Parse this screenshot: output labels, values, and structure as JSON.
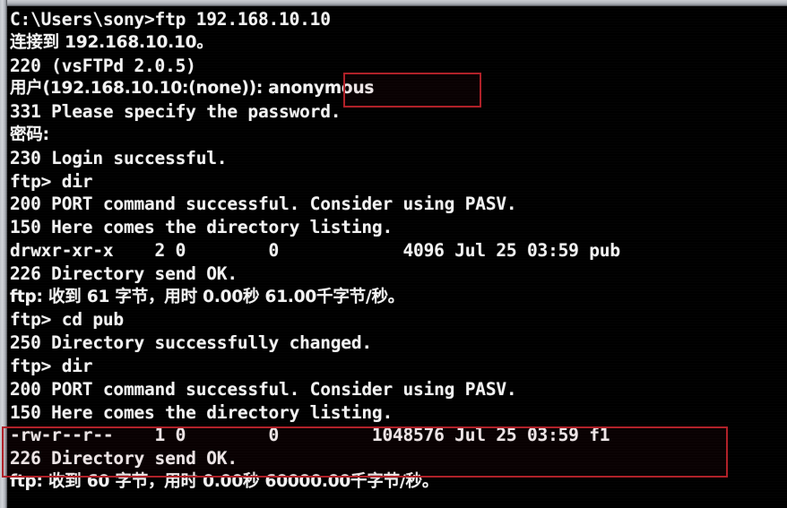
{
  "window": {
    "type": "windows-command-prompt",
    "background_color": "#000000",
    "text_color": "#f2f2f2",
    "highlight_color": "#b02028"
  },
  "terminal": {
    "lines": [
      "C:\\Users\\sony>ftp 192.168.10.10",
      "连接到 192.168.10.10。",
      "220 (vsFTPd 2.0.5)",
      "用户(192.168.10.10:(none)): anonymous",
      "331 Please specify the password.",
      "密码:",
      "230 Login successful.",
      "ftp> dir",
      "200 PORT command successful. Consider using PASV.",
      "150 Here comes the directory listing.",
      "drwxr-xr-x    2 0        0            4096 Jul 25 03:59 pub",
      "226 Directory send OK.",
      "ftp: 收到 61 字节，用时 0.00秒 61.00千字节/秒。",
      "ftp> cd pub",
      "250 Directory successfully changed.",
      "ftp> dir",
      "200 PORT command successful. Consider using PASV.",
      "150 Here comes the directory listing.",
      "-rw-r--r--    1 0        0         1048576 Jul 25 03:59 f1",
      "226 Directory send OK.",
      "ftp: 收到 60 字节，用时 0.00秒 60000.00千字节/秒。"
    ],
    "line_is_cjk": [
      false,
      true,
      false,
      true,
      false,
      true,
      false,
      false,
      false,
      false,
      false,
      false,
      true,
      false,
      false,
      false,
      false,
      false,
      false,
      false,
      true
    ]
  },
  "highlights": [
    {
      "id": "hl-anonymous",
      "label": "anonymous-username-highlight",
      "target_text": "anonymous",
      "color": "#b02028"
    },
    {
      "id": "hl-filelisting",
      "label": "file-listing-highlight",
      "target_text": "-rw-r--r--    1 0        0         1048576 Jul 25 03:59 f1",
      "color": "#b02028"
    }
  ],
  "session": {
    "prompt": "C:\\Users\\sony>",
    "command": "ftp 192.168.10.10",
    "server_host": "192.168.10.10",
    "server_banner": "220 (vsFTPd 2.0.5)",
    "ftp_server_version": "vsFTPd 2.0.5",
    "username_prompt": "用户(192.168.10.10:(none)): ",
    "username_entered": "anonymous",
    "password_prompt": "密码:",
    "login_result": "230 Login successful.",
    "directory_entries": [
      {
        "permissions": "drwxr-xr-x",
        "links": "2",
        "owner": "0",
        "group": "0",
        "size": "4096",
        "month": "Jul",
        "day": "25",
        "time": "03:59",
        "name": "pub"
      },
      {
        "permissions": "-rw-r--r--",
        "links": "1",
        "owner": "0",
        "group": "0",
        "size": "1048576",
        "month": "Jul",
        "day": "25",
        "time": "03:59",
        "name": "f1"
      }
    ],
    "transfer_stats": [
      {
        "bytes": "61",
        "seconds": "0.00",
        "rate": "61.00千字节/秒"
      },
      {
        "bytes": "60",
        "seconds": "0.00",
        "rate": "60000.00千字节/秒"
      }
    ]
  }
}
